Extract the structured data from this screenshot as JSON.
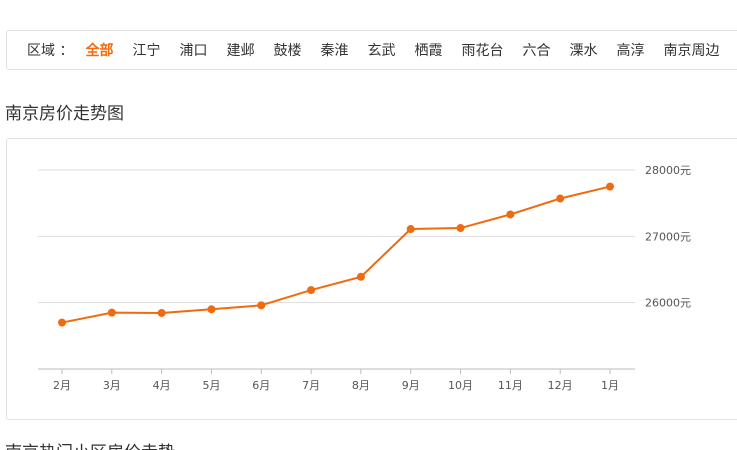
{
  "filter": {
    "label": "区域 ：",
    "items": [
      "全部",
      "江宁",
      "浦口",
      "建邺",
      "鼓楼",
      "秦淮",
      "玄武",
      "栖霞",
      "雨花台",
      "六合",
      "溧水",
      "高淳",
      "南京周边"
    ],
    "active_index": 0
  },
  "section_title": "南京房价走势图",
  "next_section_title": "南京热门小区房价走势",
  "colors": {
    "accent": "#f06a0f",
    "line": "#f06a0f",
    "grid": "#dddddd",
    "border": "#e2e2e2"
  },
  "chart_data": {
    "type": "line",
    "categories": [
      "2月",
      "3月",
      "4月",
      "5月",
      "6月",
      "7月",
      "8月",
      "9月",
      "10月",
      "11月",
      "12月",
      "1月"
    ],
    "values": [
      25700,
      25850,
      25845,
      25900,
      25960,
      26190,
      26390,
      27110,
      27125,
      27330,
      27570,
      27750
    ],
    "yticks": [
      26000,
      27000,
      28000
    ],
    "ytick_labels": [
      "26000元",
      "27000元",
      "28000元"
    ],
    "ylim": [
      25000,
      28000
    ],
    "y_axis_position": "right",
    "grid": true,
    "legend": "none"
  }
}
